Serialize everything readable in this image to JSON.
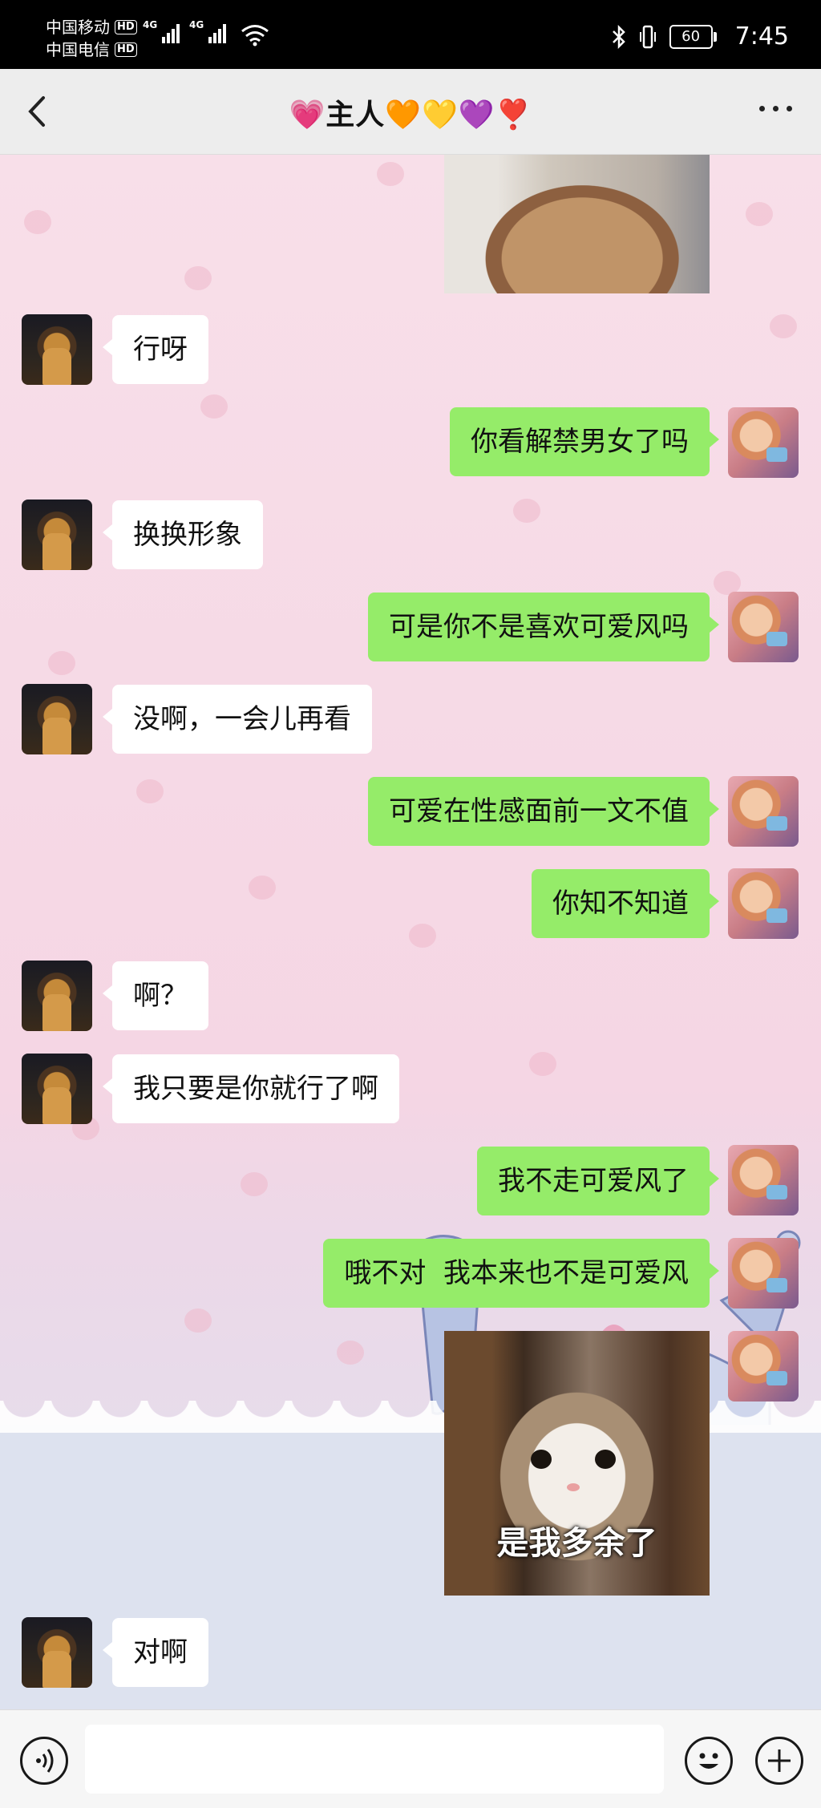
{
  "status_bar": {
    "carrier1": "中国移动",
    "carrier2": "中国电信",
    "hd": "HD",
    "net": "4G",
    "battery": "60",
    "time": "7:45",
    "icons": [
      "signal-icon",
      "wifi-icon",
      "bluetooth-icon",
      "vibrate-icon",
      "battery-icon"
    ]
  },
  "header": {
    "title": "💗主人🧡💛💜❣️",
    "back_icon": "chevron-left-icon",
    "more_icon": "more-dots-icon"
  },
  "messages": [
    {
      "side": "out",
      "type": "image",
      "desc": "cat-photo"
    },
    {
      "side": "in",
      "text": "行呀"
    },
    {
      "side": "out",
      "text": "你看解禁男女了吗"
    },
    {
      "side": "in",
      "text": "换换形象"
    },
    {
      "side": "out",
      "text": "可是你不是喜欢可爱风吗"
    },
    {
      "side": "in",
      "text": "没啊，一会儿再看"
    },
    {
      "side": "out",
      "text": "可爱在性感面前一文不值"
    },
    {
      "side": "out",
      "text": "你知不知道"
    },
    {
      "side": "in",
      "text": "啊？"
    },
    {
      "side": "in",
      "text": "我只要是你就行了啊"
    },
    {
      "side": "out",
      "text": "我不走可爱风了"
    },
    {
      "side": "out",
      "text": "哦不对  我本来也不是可爱风"
    },
    {
      "side": "out",
      "type": "image",
      "caption": "是我多余了"
    },
    {
      "side": "in",
      "text": "对啊"
    }
  ],
  "input_bar": {
    "placeholder": "",
    "voice_icon": "voice-icon",
    "emoji_icon": "emoji-icon",
    "plus_icon": "plus-icon"
  },
  "colors": {
    "outgoing_bubble": "#95ec69",
    "incoming_bubble": "#ffffff",
    "header_bg": "#ededed"
  }
}
